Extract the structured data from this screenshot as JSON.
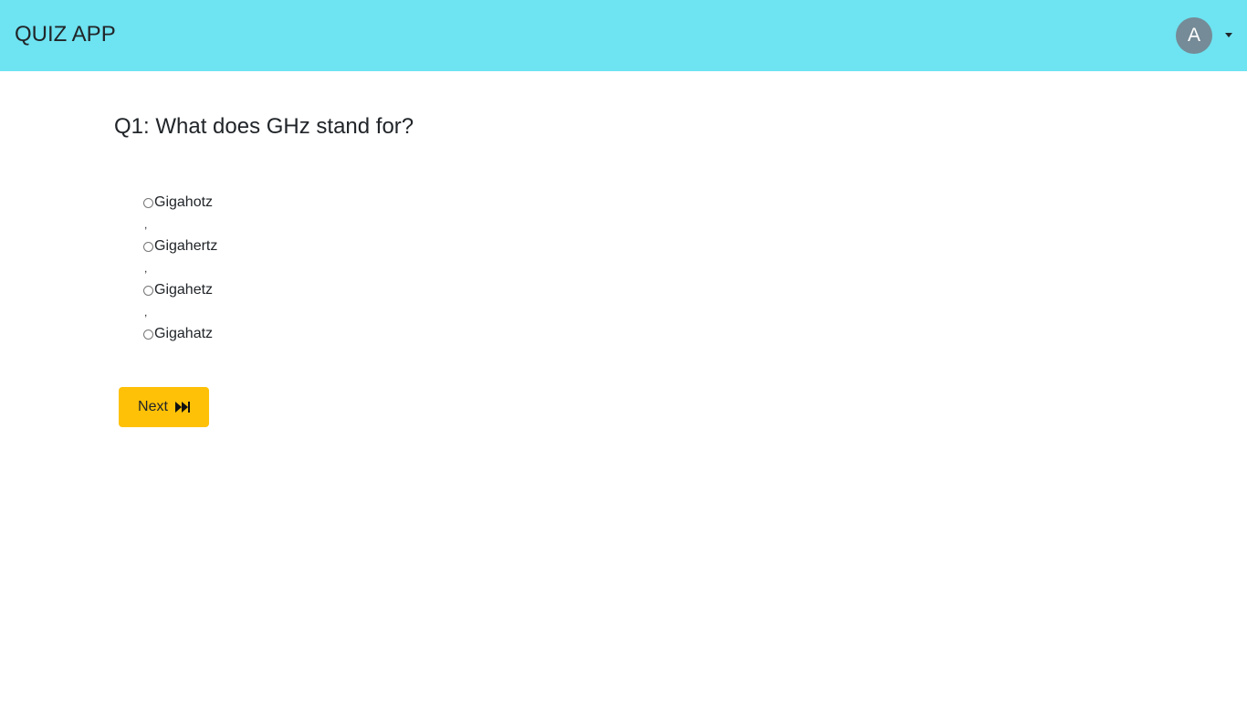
{
  "navbar": {
    "brand": "QUIZ APP",
    "avatar_initial": "A",
    "avatar_icon": "avatar-circle",
    "menu_icon": "caret-down-icon",
    "background_color": "#6ee3f1"
  },
  "question": {
    "text": "Q1: What does GHz stand for?",
    "options": [
      {
        "label": "Gigahotz",
        "selected": false
      },
      {
        "label": "Gigahertz",
        "selected": false
      },
      {
        "label": "Gigahetz",
        "selected": false
      },
      {
        "label": "Gigahatz",
        "selected": false
      }
    ],
    "separator": ","
  },
  "actions": {
    "next_label": "Next",
    "next_icon": "fast-forward-icon",
    "next_color": "#ffc107"
  }
}
